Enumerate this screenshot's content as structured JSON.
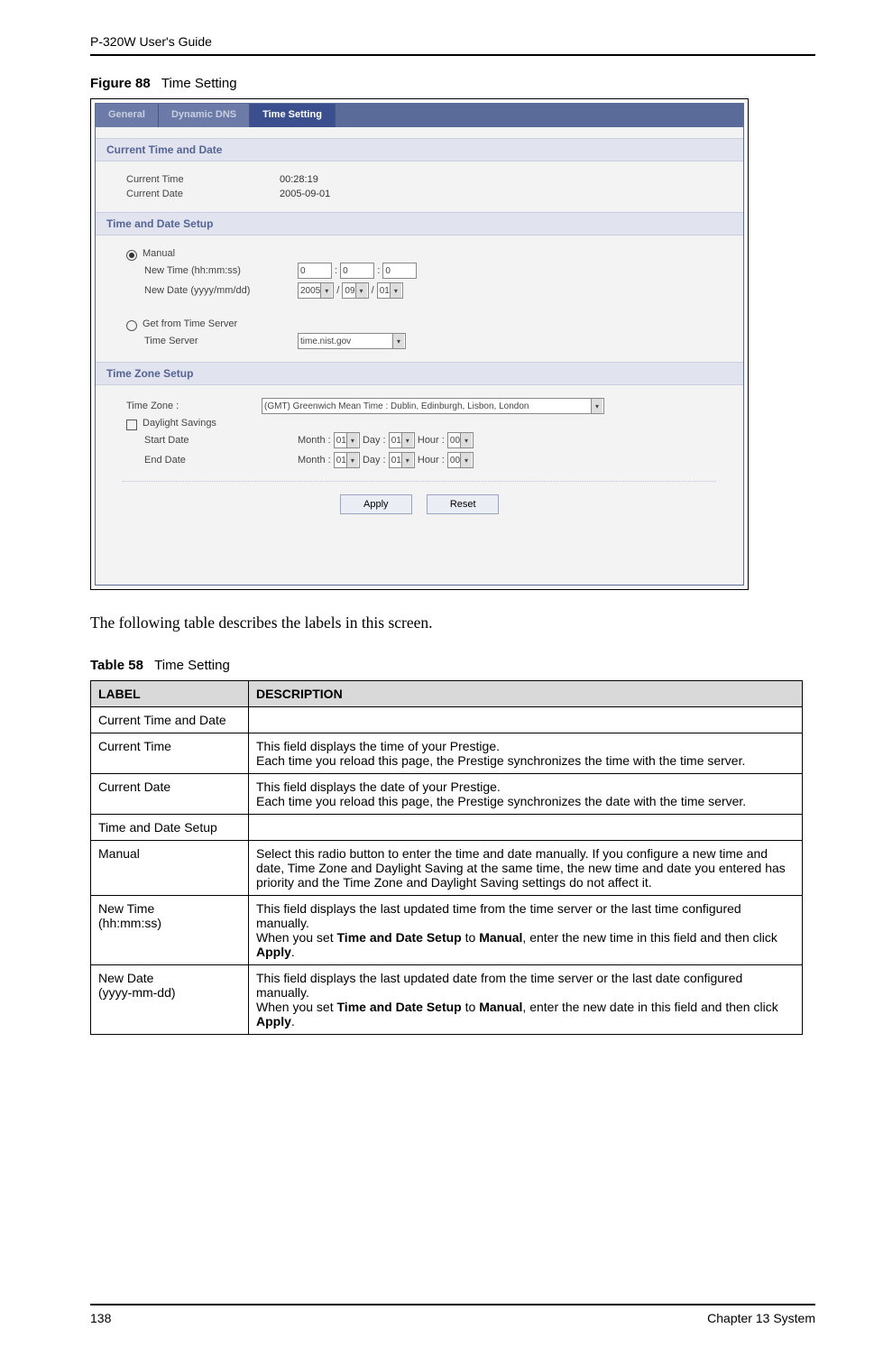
{
  "running_head": "P-320W User's Guide",
  "figure_caption_num": "Figure 88",
  "figure_caption_title": "Time Setting",
  "screenshot": {
    "tabs": [
      "General",
      "Dynamic DNS",
      "Time Setting"
    ],
    "active_tab_index": 2,
    "sections": {
      "current": {
        "title": "Current Time and Date",
        "time_label": "Current Time",
        "time_value": "00:28:19",
        "date_label": "Current Date",
        "date_value": "2005-09-01"
      },
      "setup": {
        "title": "Time and Date Setup",
        "manual_label": "Manual",
        "new_time_label": "New Time (hh:mm:ss)",
        "new_time": [
          "0",
          "0",
          "0"
        ],
        "new_date_label": "New Date (yyyy/mm/dd)",
        "new_date": [
          "2005",
          "09",
          "01"
        ],
        "server_label": "Get from Time Server",
        "time_server_label": "Time Server",
        "time_server_value": "time.nist.gov"
      },
      "tz": {
        "title": "Time Zone Setup",
        "tz_label": "Time Zone :",
        "tz_value": "(GMT) Greenwich Mean Time : Dublin, Edinburgh, Lisbon, London",
        "dst_label": "Daylight Savings",
        "start_label": "Start Date",
        "end_label": "End Date",
        "month_label": "Month :",
        "day_label": "Day :",
        "hour_label": "Hour :",
        "mdh": [
          "01",
          "01",
          "00"
        ]
      },
      "buttons": {
        "apply": "Apply",
        "reset": "Reset"
      }
    }
  },
  "body_text": "The following table describes the labels in this screen.",
  "table_caption_num": "Table 58",
  "table_caption_title": "Time Setting",
  "table": {
    "head_label": "LABEL",
    "head_desc": "DESCRIPTION",
    "rows": [
      {
        "label": "Current Time and Date",
        "desc": ""
      },
      {
        "label": "Current Time",
        "desc": "This field displays the time of your Prestige.\nEach time you reload this page, the Prestige synchronizes the time with the time server."
      },
      {
        "label": "Current Date",
        "desc": "This field displays the date of your Prestige.\nEach time you reload this page, the Prestige synchronizes the date with the time server."
      },
      {
        "label": "Time and Date Setup",
        "desc": ""
      },
      {
        "label": "Manual",
        "desc": "Select this radio button to enter the time and date manually. If you configure a new time and date, Time Zone and Daylight Saving at the same time, the new time and date you entered has priority and the Time Zone and Daylight Saving settings do not affect it."
      },
      {
        "label": "New Time\n (hh:mm:ss)",
        "desc_parts": [
          {
            "t": "This field displays the last updated time from the time server or the last time configured manually.\nWhen you set "
          },
          {
            "t": "Time and Date Setup",
            "b": true
          },
          {
            "t": " to "
          },
          {
            "t": "Manual",
            "b": true
          },
          {
            "t": ", enter the new time in this field and then click "
          },
          {
            "t": "Apply",
            "b": true
          },
          {
            "t": "."
          }
        ]
      },
      {
        "label": "New Date\n(yyyy-mm-dd)",
        "desc_parts": [
          {
            "t": "This field displays the last updated date from the time server or the last date configured manually.\nWhen you set "
          },
          {
            "t": "Time and Date Setup",
            "b": true
          },
          {
            "t": " to "
          },
          {
            "t": "Manual",
            "b": true
          },
          {
            "t": ", enter the new date in this field and then click "
          },
          {
            "t": "Apply",
            "b": true
          },
          {
            "t": "."
          }
        ]
      }
    ]
  },
  "footer": {
    "page": "138",
    "chapter": "Chapter 13 System"
  }
}
